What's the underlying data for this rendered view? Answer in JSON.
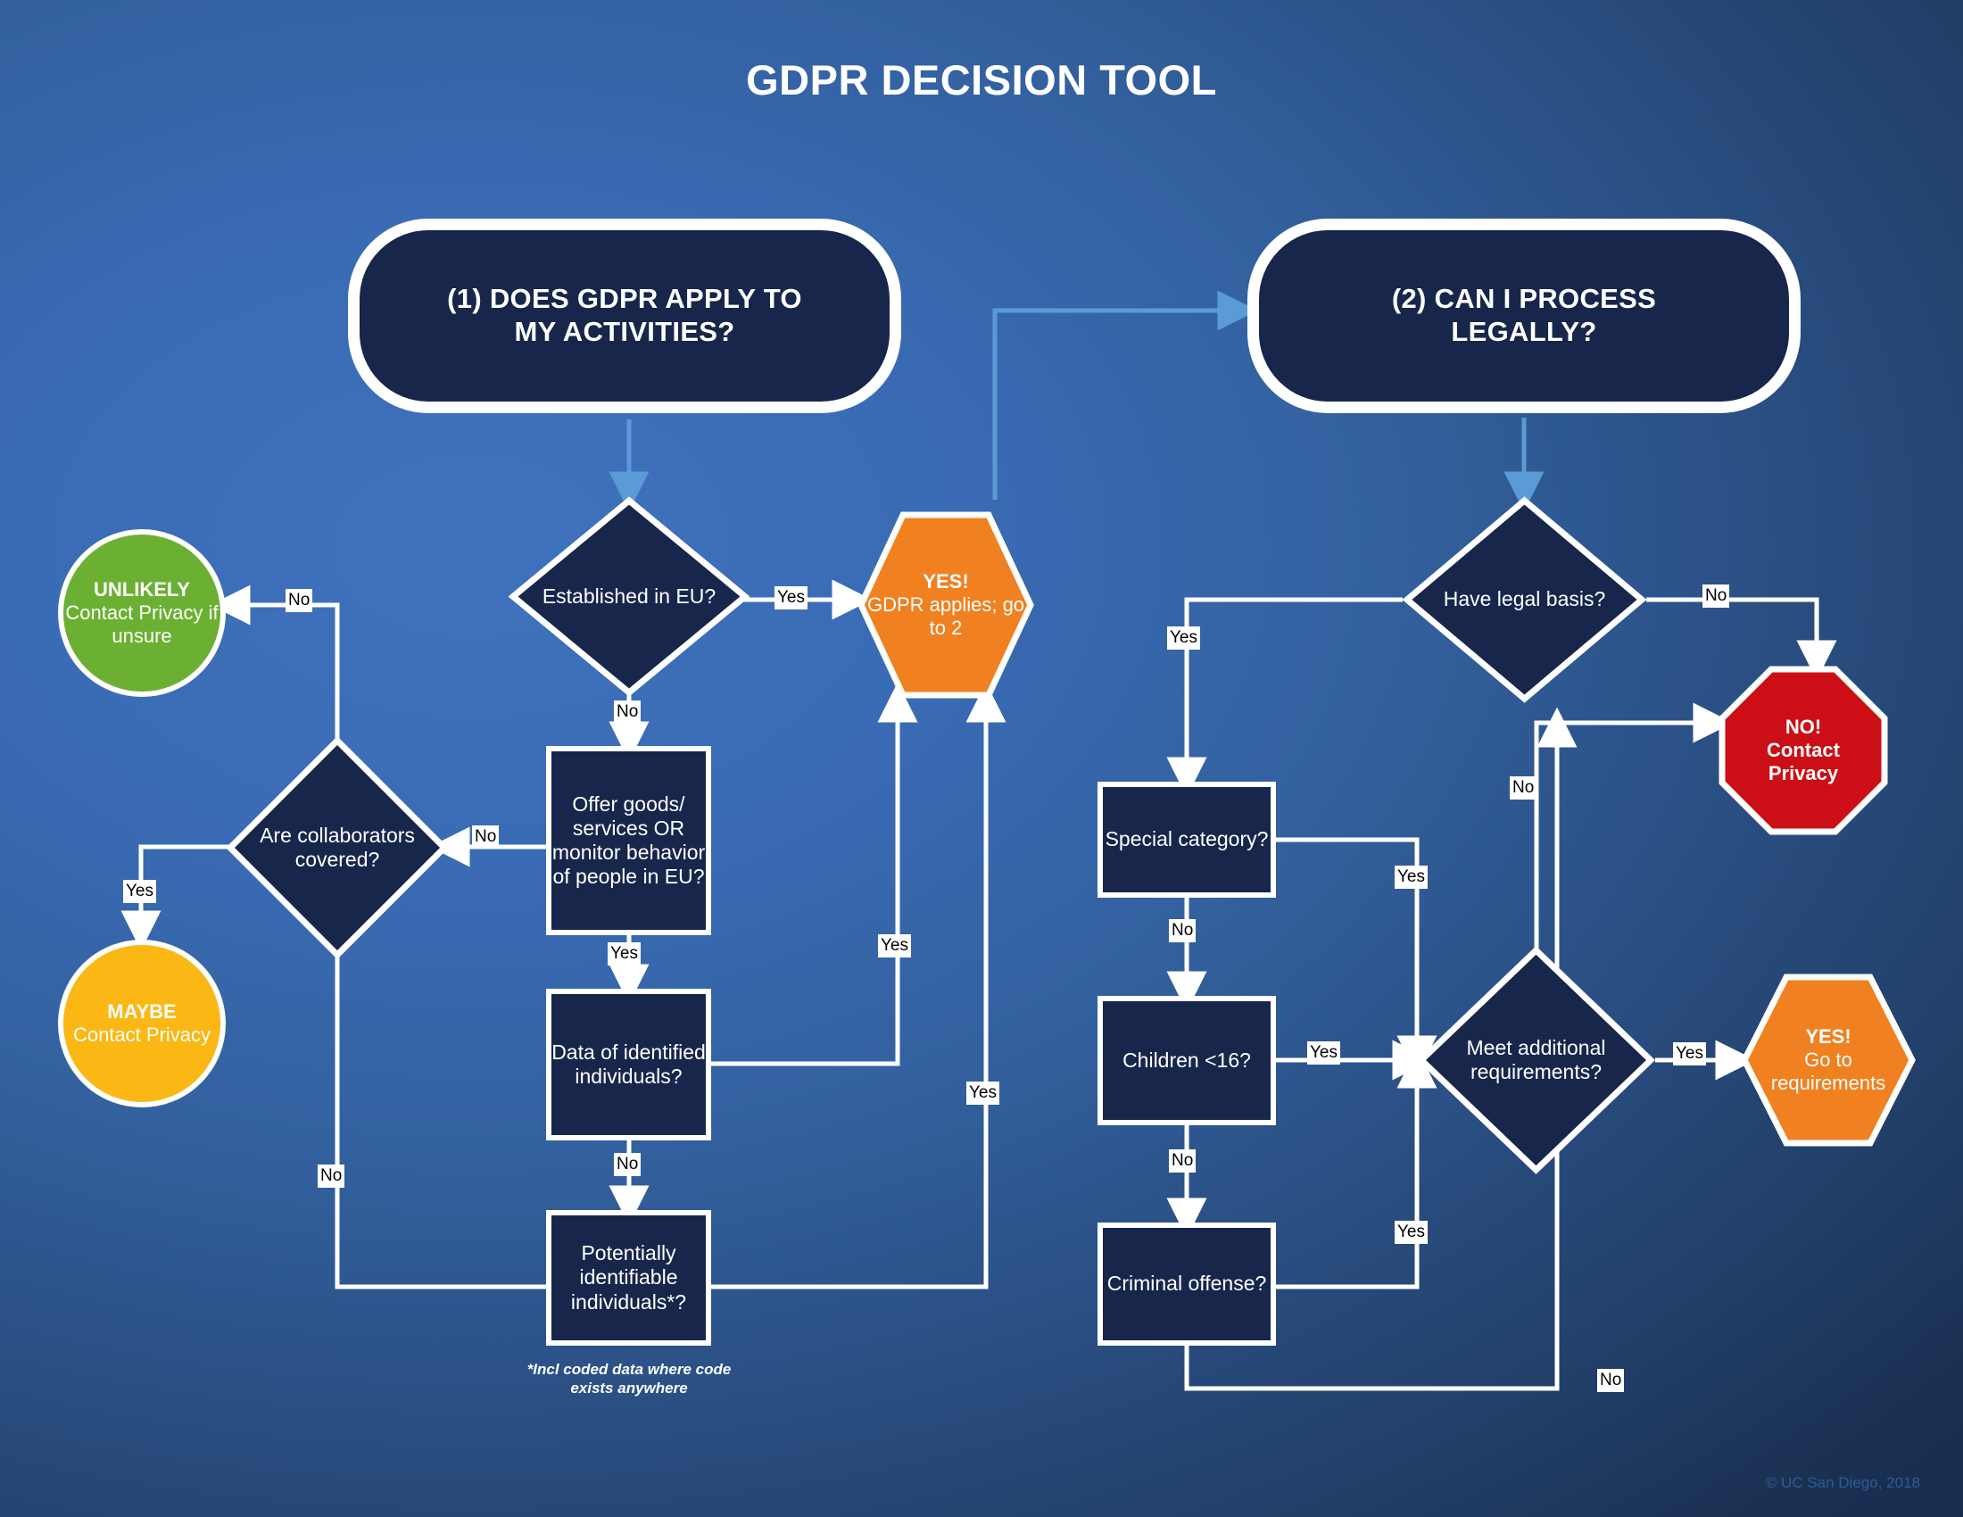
{
  "title": "GDPR DECISION TOOL",
  "copyright": "© UC San Diego, 2018",
  "footnote": "*Incl coded data where code exists anywhere",
  "colors": {
    "background_top_left": "#3f72bd",
    "background_bottom_right": "#16294a",
    "node_fill": "#17264a",
    "node_border": "#ffffff",
    "accent_orange": "#f08020",
    "accent_red": "#cc0e16",
    "accent_green": "#6cb033",
    "accent_yellow": "#fbb713",
    "arrow_blue": "#5b9bd5",
    "arrow_white": "#ffffff"
  },
  "sections": {
    "one": {
      "label": "(1) DOES GDPR APPLY TO MY ACTIVITIES?",
      "line1": "(1) DOES GDPR APPLY TO",
      "line2": "MY ACTIVITIES?"
    },
    "two": {
      "label": "(2)  CAN I PROCESS LEGALLY?",
      "line1": "(2)  CAN I PROCESS",
      "line2": "LEGALLY?"
    }
  },
  "nodes": {
    "established_eu": {
      "label": "Established in EU?",
      "shape": "diamond"
    },
    "offer_goods": {
      "label": "Offer goods/ services OR monitor behavior of people in EU?",
      "shape": "rect"
    },
    "data_identified": {
      "label": "Data of identified individuals?",
      "shape": "rect"
    },
    "potentially_identifiable": {
      "label": "Potentially identifiable individuals*?",
      "shape": "rect"
    },
    "collaborators": {
      "label": "Are collaborators covered?",
      "shape": "diamond"
    },
    "unlikely": {
      "shape": "circle",
      "headline": "UNLIKELY",
      "body": "Contact Privacy if unsure"
    },
    "maybe": {
      "shape": "circle",
      "headline": "MAYBE",
      "body": "Contact Privacy"
    },
    "gdpr_applies": {
      "shape": "hexagon",
      "headline": "YES!",
      "body": "GDPR applies; go to 2"
    },
    "legal_basis": {
      "label": "Have legal basis?",
      "shape": "diamond"
    },
    "special_category": {
      "label": "Special category?",
      "shape": "rect"
    },
    "children": {
      "label": "Children <16?",
      "shape": "rect"
    },
    "criminal": {
      "label": "Criminal offense?",
      "shape": "rect"
    },
    "meet_additional": {
      "label": "Meet additional requirements?",
      "shape": "diamond"
    },
    "no_contact_privacy": {
      "shape": "octagon",
      "headline": "NO!",
      "line2": "Contact",
      "line3": "Privacy"
    },
    "go_to_requirements": {
      "shape": "hexagon",
      "headline": "YES!",
      "line2": "Go to",
      "line3": "requirements"
    }
  },
  "edge_labels": {
    "eu_yes": "Yes",
    "eu_no": "No",
    "offer_yes": "Yes",
    "offer_no": "No",
    "data_no": "No",
    "data_yes": "Yes",
    "potential_yes": "Yes",
    "potential_no": "No",
    "collab_no": "No",
    "collab_yes": "Yes",
    "legal_basis_no": "No",
    "legal_basis_yes": "Yes",
    "special_yes": "Yes",
    "special_no": "No",
    "children_yes": "Yes",
    "children_no": "No",
    "criminal_yes": "Yes",
    "criminal_no": "No",
    "meet_yes": "Yes",
    "meet_no": "No"
  }
}
